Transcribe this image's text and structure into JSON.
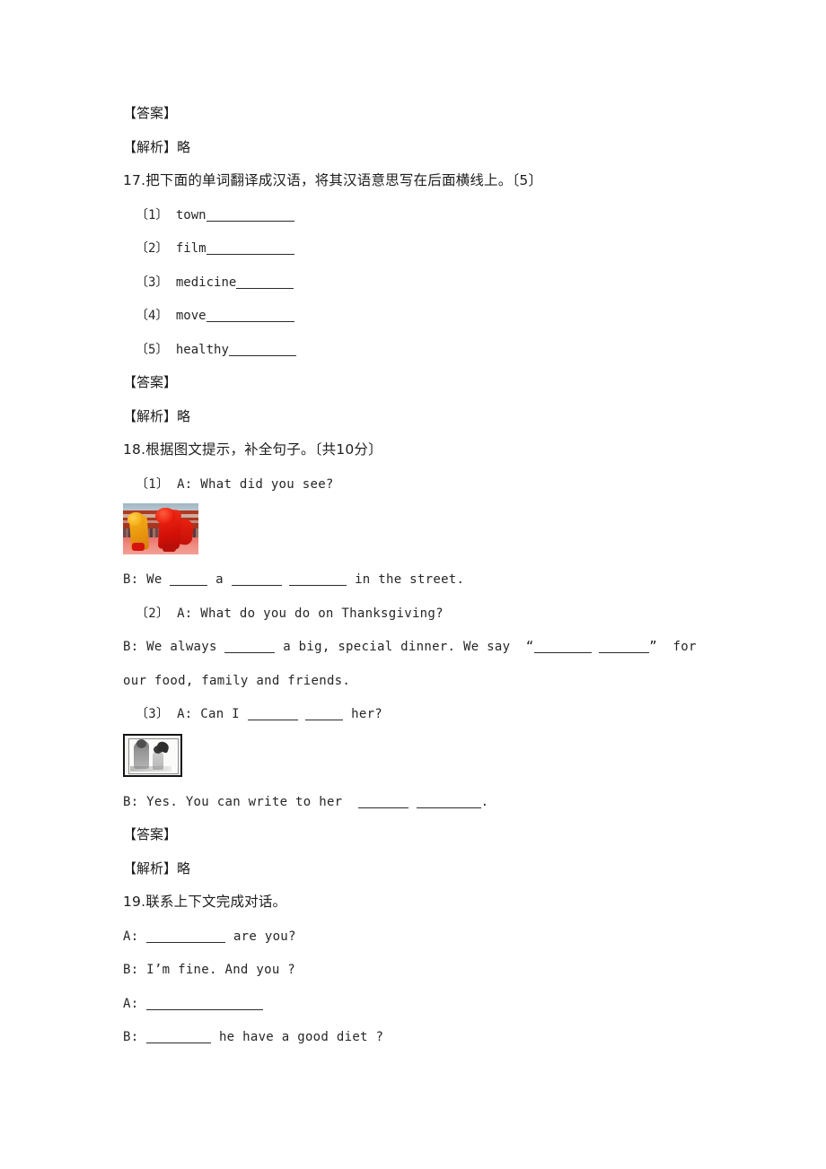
{
  "page": {
    "answer_label": "【答案】",
    "analysis_label": "【解析】略"
  },
  "q17": {
    "heading": "17.把下面的单词翻译成汉语，将其汉语意思写在后面横线上。〔5〕",
    "items": [
      {
        "num": "〔1〕",
        "word": "town",
        "rule_width": 98
      },
      {
        "num": "〔2〕",
        "word": "film",
        "rule_width": 98
      },
      {
        "num": "〔3〕",
        "word": "medicine",
        "rule_width": 64
      },
      {
        "num": "〔4〕",
        "word": "move",
        "rule_width": 98
      },
      {
        "num": "〔5〕",
        "word": "healthy",
        "rule_width": 75
      }
    ],
    "answer_label": "【答案】",
    "analysis_label": "【解析】略"
  },
  "q18": {
    "heading": "18.根据图文提示，补全句子。〔共10分〕",
    "p1": {
      "num": "〔1〕",
      "a_line": "A: What did you see?",
      "image_name": "lion-dance-photo",
      "b_pre": "B: We",
      "b_mid1": "a",
      "b_post": "in the street."
    },
    "p2": {
      "num": "〔2〕",
      "a_line": "A: What do you do on Thanksgiving?",
      "b_pre": "B: We always",
      "b_mid": "a big, special dinner. We say",
      "open_quote": "“",
      "close_quote": "”",
      "b_tail": "for",
      "b_line2": "our food, family and friends."
    },
    "p3": {
      "num": "〔3〕",
      "a_pre": "A: Can I",
      "a_post": "her?",
      "image_name": "framed-photo",
      "b_pre": "B: Yes. You can write to her",
      "b_post": "."
    },
    "answer_label": "【答案】",
    "analysis_label": "【解析】略"
  },
  "q19": {
    "heading": "19.联系上下文完成对话。",
    "l1_pre": "A:",
    "l1_post": "are you?",
    "l2": "B: I’m fine. And you ?",
    "l3_pre": "A:",
    "l4_pre": "B:",
    "l4_post": "he have a good diet ?"
  }
}
